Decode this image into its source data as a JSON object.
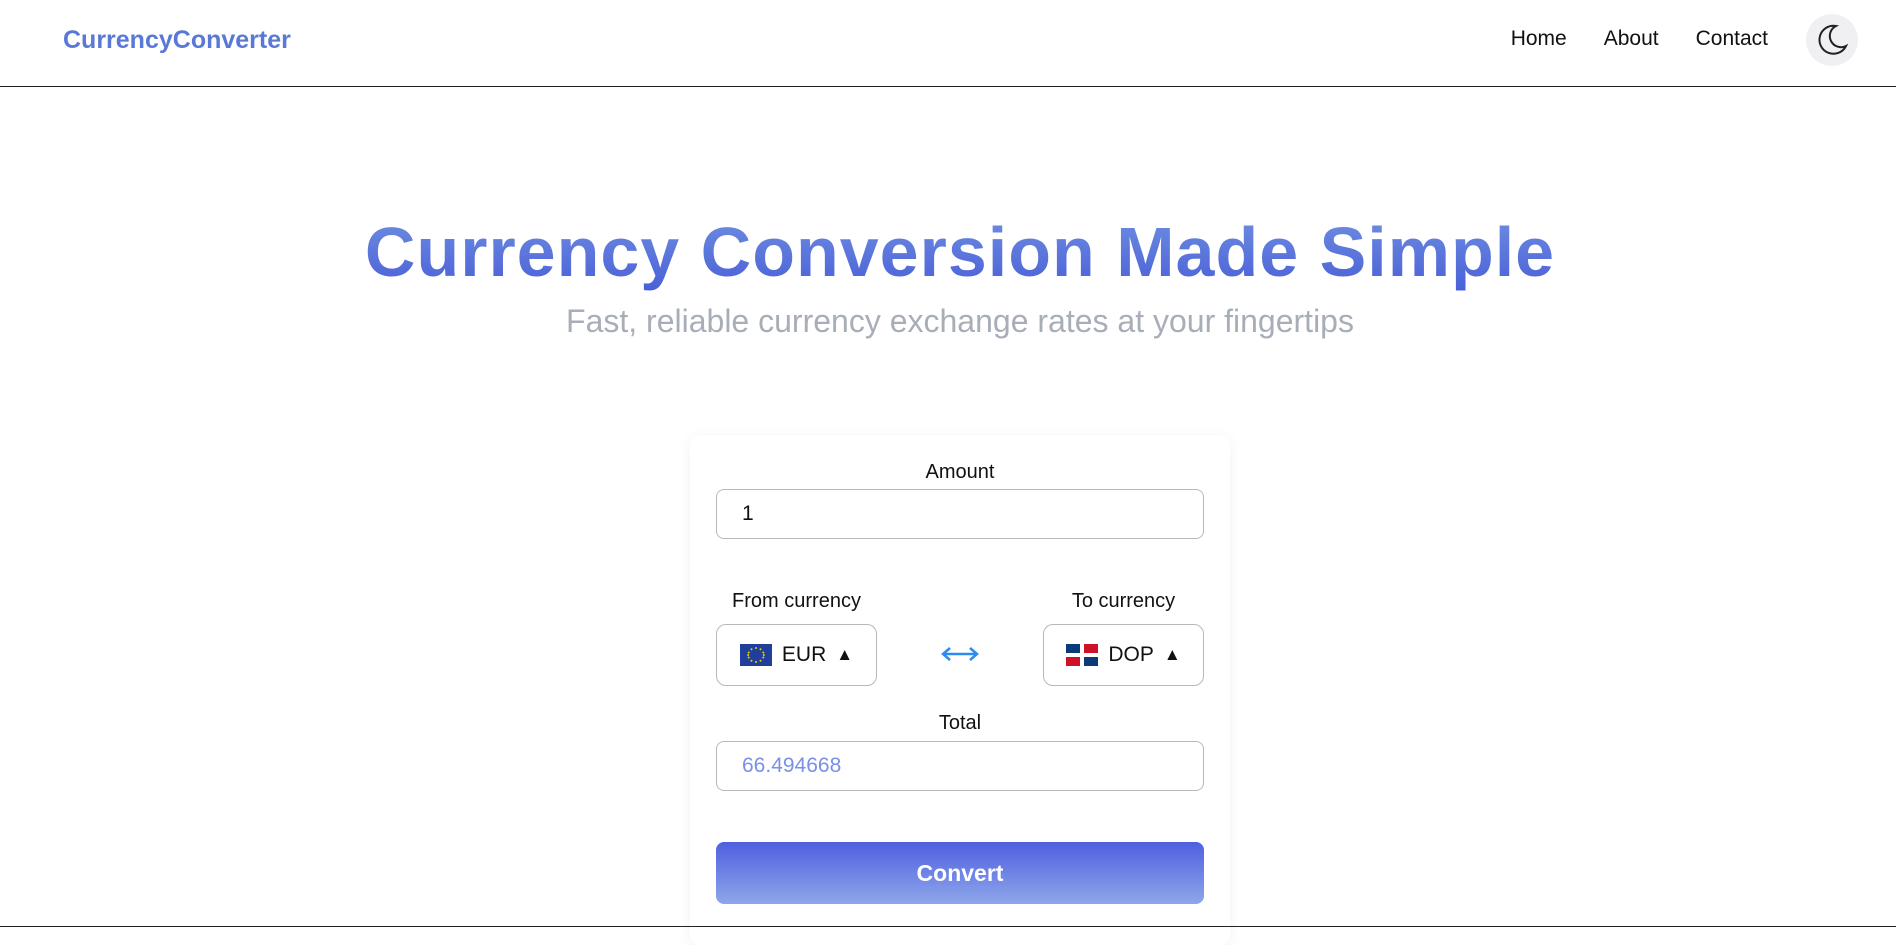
{
  "navbar": {
    "brand": "CurrencyConverter",
    "links": [
      "Home",
      "About",
      "Contact"
    ],
    "theme_icon": "moon-icon"
  },
  "hero": {
    "title": "Currency Conversion Made Simple",
    "subtitle": "Fast, reliable currency exchange rates at your fingertips"
  },
  "converter": {
    "amount_label": "Amount",
    "amount_value": "1",
    "from_label": "From currency",
    "from_code": "EUR",
    "from_flag": "eu-flag-icon",
    "to_label": "To currency",
    "to_code": "DOP",
    "to_flag": "dominican-republic-flag-icon",
    "swap_icon": "swap-arrows-icon",
    "total_label": "Total",
    "total_value": "66.494668",
    "convert_label": "Convert"
  },
  "colors": {
    "brand": "#5a78d6",
    "accent_gradient_start": "#4f5fe0",
    "accent_gradient_end": "#8ea7ea",
    "swap_arrow": "#2a8cf0",
    "total_text": "#7a8fe8"
  }
}
